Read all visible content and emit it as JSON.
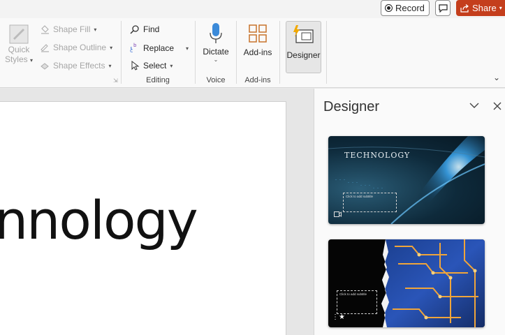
{
  "titlebar": {
    "record_label": "Record",
    "share_label": "Share"
  },
  "ribbon": {
    "drawing": {
      "quick_styles_line1": "Quick",
      "quick_styles_line2": "Styles",
      "shape_fill": "Shape Fill",
      "shape_outline": "Shape Outline",
      "shape_effects": "Shape Effects"
    },
    "editing": {
      "find": "Find",
      "replace": "Replace",
      "select": "Select",
      "group_label": "Editing"
    },
    "voice": {
      "dictate": "Dictate",
      "group_label": "Voice"
    },
    "addins": {
      "addins": "Add-ins",
      "group_label": "Add-ins"
    },
    "designer": {
      "label": "Designer"
    }
  },
  "slide": {
    "title_fragment": "nnology"
  },
  "designer_pane": {
    "title": "Designer",
    "thumbnails": [
      {
        "title": "TECHNOLOGY",
        "subtitle_placeholder": "Click to add subtitle"
      },
      {
        "subtitle_placeholder": "Click to add subtitle"
      }
    ]
  },
  "colors": {
    "share": "#c43e1c",
    "mic": "#3b8ad9",
    "addins_icon": "#c8732a",
    "designer_bolt": "#f2a900"
  }
}
